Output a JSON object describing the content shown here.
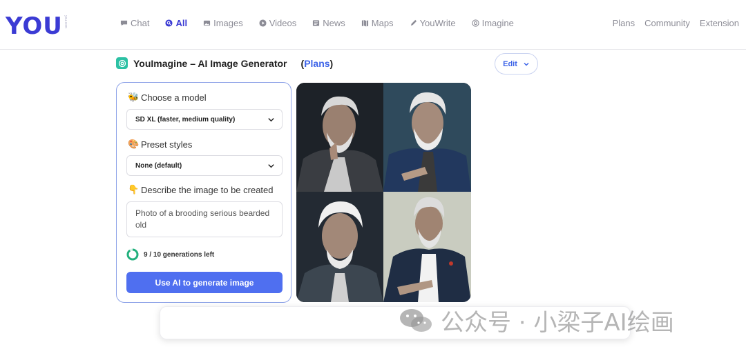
{
  "header": {
    "logo": "YOU",
    "logo_small": "you.com",
    "nav": [
      {
        "label": "Chat",
        "icon": "chat-icon",
        "active": false
      },
      {
        "label": "All",
        "icon": "search-icon",
        "active": true
      },
      {
        "label": "Images",
        "icon": "images-icon",
        "active": false
      },
      {
        "label": "Videos",
        "icon": "play-icon",
        "active": false
      },
      {
        "label": "News",
        "icon": "news-icon",
        "active": false
      },
      {
        "label": "Maps",
        "icon": "map-icon",
        "active": false
      },
      {
        "label": "YouWrite",
        "icon": "pen-icon",
        "active": false
      },
      {
        "label": "Imagine",
        "icon": "imagine-icon",
        "active": false
      }
    ],
    "right_links": [
      "Plans",
      "Community",
      "Extension"
    ]
  },
  "app": {
    "title": "YouImagine – AI Image Generator",
    "plans_open": "(",
    "plans_label": "Plans",
    "plans_close": ")",
    "edit_label": "Edit"
  },
  "panel": {
    "model_label": "Choose a model",
    "model_value": "SD XL (faster, medium quality)",
    "style_label": "Preset styles",
    "style_value": "None (default)",
    "describe_label": "Describe the image to be created",
    "prompt_value": "Photo of a brooding serious bearded old",
    "generations": "9 / 10 generations left",
    "generate_button": "Use AI to generate image"
  },
  "watermark": {
    "text": "公众号 · 小梁子AI绘画"
  },
  "colors": {
    "brand": "#3b3bd4",
    "accent": "#4f6ff0",
    "progress": "#22b07d"
  }
}
